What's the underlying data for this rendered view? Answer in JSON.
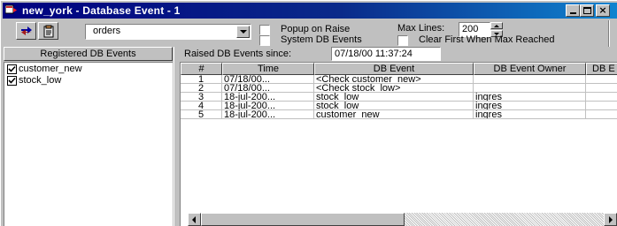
{
  "window": {
    "title": "new_york - Database Event - 1",
    "icon": "db-event-app-icon",
    "controls": [
      "minimize-icon",
      "maximize-icon",
      "close-icon"
    ]
  },
  "toolbar": {
    "refresh_icon": "refresh-arrows-icon",
    "clipboard_icon": "clipboard-icon",
    "database_select": {
      "value": "orders"
    },
    "popup_on_raise": {
      "label": "Popup on Raise",
      "checked": false
    },
    "system_db_events": {
      "label": "System DB Events",
      "checked": false
    },
    "max_lines": {
      "label": "Max Lines:",
      "value": "200"
    },
    "clear_first": {
      "label": "Clear First When Max Reached",
      "checked": false
    }
  },
  "left_panel": {
    "header": "Registered DB Events",
    "items": [
      {
        "label": "customer_new",
        "checked": true
      },
      {
        "label": "stock_low",
        "checked": true
      }
    ]
  },
  "right_panel": {
    "raised_label": "Raised DB Events since:",
    "raised_value": "07/18/00 11:37:24",
    "columns": [
      "#",
      "Time",
      "DB Event",
      "DB Event Owner",
      "DB E"
    ],
    "rows": [
      {
        "num": "1",
        "time": "07/18/00...",
        "event": "<Check customer_new>",
        "owner": "",
        "extra": ""
      },
      {
        "num": "2",
        "time": "07/18/00...",
        "event": "<Check stock_low>",
        "owner": "",
        "extra": ""
      },
      {
        "num": "3",
        "time": "18-jul-200...",
        "event": "stock_low",
        "owner": "ingres",
        "extra": ""
      },
      {
        "num": "4",
        "time": "18-jul-200...",
        "event": "stock_low",
        "owner": "ingres",
        "extra": ""
      },
      {
        "num": "5",
        "time": "18-jul-200...",
        "event": "customer_new",
        "owner": "ingres",
        "extra": ""
      }
    ]
  },
  "colors": {
    "title_bar_start": "#000080",
    "title_bar_end": "#1084d0",
    "face": "#c0c0c0"
  }
}
